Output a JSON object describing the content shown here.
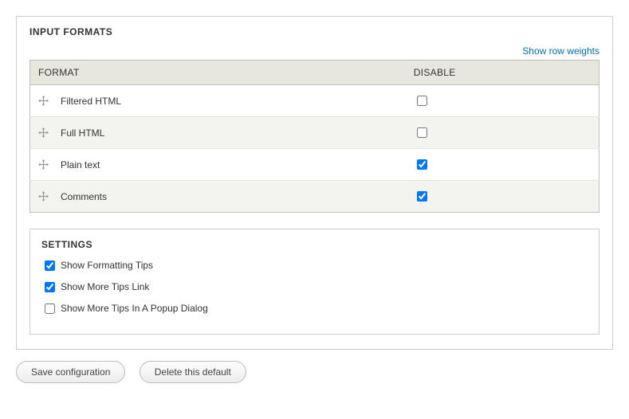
{
  "fieldset_title": "INPUT FORMATS",
  "show_row_weights": "Show row weights",
  "table": {
    "headers": {
      "format": "FORMAT",
      "disable": "DISABLE"
    },
    "rows": [
      {
        "label": "Filtered HTML",
        "disabled": false
      },
      {
        "label": "Full HTML",
        "disabled": false
      },
      {
        "label": "Plain text",
        "disabled": true
      },
      {
        "label": "Comments",
        "disabled": true
      }
    ]
  },
  "settings": {
    "title": "SETTINGS",
    "items": [
      {
        "label": "Show Formatting Tips",
        "checked": true
      },
      {
        "label": "Show More Tips Link",
        "checked": true
      },
      {
        "label": "Show More Tips In A Popup Dialog",
        "checked": false
      }
    ]
  },
  "buttons": {
    "save": "Save configuration",
    "delete": "Delete this default"
  }
}
